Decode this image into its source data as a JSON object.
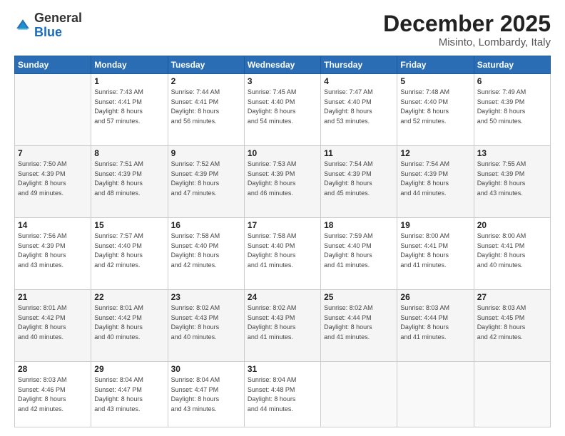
{
  "header": {
    "logo_general": "General",
    "logo_blue": "Blue",
    "month_title": "December 2025",
    "location": "Misinto, Lombardy, Italy"
  },
  "weekdays": [
    "Sunday",
    "Monday",
    "Tuesday",
    "Wednesday",
    "Thursday",
    "Friday",
    "Saturday"
  ],
  "weeks": [
    [
      {
        "day": "",
        "sunrise": "",
        "sunset": "",
        "daylight": ""
      },
      {
        "day": "1",
        "sunrise": "Sunrise: 7:43 AM",
        "sunset": "Sunset: 4:41 PM",
        "daylight": "Daylight: 8 hours and 57 minutes."
      },
      {
        "day": "2",
        "sunrise": "Sunrise: 7:44 AM",
        "sunset": "Sunset: 4:41 PM",
        "daylight": "Daylight: 8 hours and 56 minutes."
      },
      {
        "day": "3",
        "sunrise": "Sunrise: 7:45 AM",
        "sunset": "Sunset: 4:40 PM",
        "daylight": "Daylight: 8 hours and 54 minutes."
      },
      {
        "day": "4",
        "sunrise": "Sunrise: 7:47 AM",
        "sunset": "Sunset: 4:40 PM",
        "daylight": "Daylight: 8 hours and 53 minutes."
      },
      {
        "day": "5",
        "sunrise": "Sunrise: 7:48 AM",
        "sunset": "Sunset: 4:40 PM",
        "daylight": "Daylight: 8 hours and 52 minutes."
      },
      {
        "day": "6",
        "sunrise": "Sunrise: 7:49 AM",
        "sunset": "Sunset: 4:39 PM",
        "daylight": "Daylight: 8 hours and 50 minutes."
      }
    ],
    [
      {
        "day": "7",
        "sunrise": "Sunrise: 7:50 AM",
        "sunset": "Sunset: 4:39 PM",
        "daylight": "Daylight: 8 hours and 49 minutes."
      },
      {
        "day": "8",
        "sunrise": "Sunrise: 7:51 AM",
        "sunset": "Sunset: 4:39 PM",
        "daylight": "Daylight: 8 hours and 48 minutes."
      },
      {
        "day": "9",
        "sunrise": "Sunrise: 7:52 AM",
        "sunset": "Sunset: 4:39 PM",
        "daylight": "Daylight: 8 hours and 47 minutes."
      },
      {
        "day": "10",
        "sunrise": "Sunrise: 7:53 AM",
        "sunset": "Sunset: 4:39 PM",
        "daylight": "Daylight: 8 hours and 46 minutes."
      },
      {
        "day": "11",
        "sunrise": "Sunrise: 7:54 AM",
        "sunset": "Sunset: 4:39 PM",
        "daylight": "Daylight: 8 hours and 45 minutes."
      },
      {
        "day": "12",
        "sunrise": "Sunrise: 7:54 AM",
        "sunset": "Sunset: 4:39 PM",
        "daylight": "Daylight: 8 hours and 44 minutes."
      },
      {
        "day": "13",
        "sunrise": "Sunrise: 7:55 AM",
        "sunset": "Sunset: 4:39 PM",
        "daylight": "Daylight: 8 hours and 43 minutes."
      }
    ],
    [
      {
        "day": "14",
        "sunrise": "Sunrise: 7:56 AM",
        "sunset": "Sunset: 4:39 PM",
        "daylight": "Daylight: 8 hours and 43 minutes."
      },
      {
        "day": "15",
        "sunrise": "Sunrise: 7:57 AM",
        "sunset": "Sunset: 4:40 PM",
        "daylight": "Daylight: 8 hours and 42 minutes."
      },
      {
        "day": "16",
        "sunrise": "Sunrise: 7:58 AM",
        "sunset": "Sunset: 4:40 PM",
        "daylight": "Daylight: 8 hours and 42 minutes."
      },
      {
        "day": "17",
        "sunrise": "Sunrise: 7:58 AM",
        "sunset": "Sunset: 4:40 PM",
        "daylight": "Daylight: 8 hours and 41 minutes."
      },
      {
        "day": "18",
        "sunrise": "Sunrise: 7:59 AM",
        "sunset": "Sunset: 4:40 PM",
        "daylight": "Daylight: 8 hours and 41 minutes."
      },
      {
        "day": "19",
        "sunrise": "Sunrise: 8:00 AM",
        "sunset": "Sunset: 4:41 PM",
        "daylight": "Daylight: 8 hours and 41 minutes."
      },
      {
        "day": "20",
        "sunrise": "Sunrise: 8:00 AM",
        "sunset": "Sunset: 4:41 PM",
        "daylight": "Daylight: 8 hours and 40 minutes."
      }
    ],
    [
      {
        "day": "21",
        "sunrise": "Sunrise: 8:01 AM",
        "sunset": "Sunset: 4:42 PM",
        "daylight": "Daylight: 8 hours and 40 minutes."
      },
      {
        "day": "22",
        "sunrise": "Sunrise: 8:01 AM",
        "sunset": "Sunset: 4:42 PM",
        "daylight": "Daylight: 8 hours and 40 minutes."
      },
      {
        "day": "23",
        "sunrise": "Sunrise: 8:02 AM",
        "sunset": "Sunset: 4:43 PM",
        "daylight": "Daylight: 8 hours and 40 minutes."
      },
      {
        "day": "24",
        "sunrise": "Sunrise: 8:02 AM",
        "sunset": "Sunset: 4:43 PM",
        "daylight": "Daylight: 8 hours and 41 minutes."
      },
      {
        "day": "25",
        "sunrise": "Sunrise: 8:02 AM",
        "sunset": "Sunset: 4:44 PM",
        "daylight": "Daylight: 8 hours and 41 minutes."
      },
      {
        "day": "26",
        "sunrise": "Sunrise: 8:03 AM",
        "sunset": "Sunset: 4:44 PM",
        "daylight": "Daylight: 8 hours and 41 minutes."
      },
      {
        "day": "27",
        "sunrise": "Sunrise: 8:03 AM",
        "sunset": "Sunset: 4:45 PM",
        "daylight": "Daylight: 8 hours and 42 minutes."
      }
    ],
    [
      {
        "day": "28",
        "sunrise": "Sunrise: 8:03 AM",
        "sunset": "Sunset: 4:46 PM",
        "daylight": "Daylight: 8 hours and 42 minutes."
      },
      {
        "day": "29",
        "sunrise": "Sunrise: 8:04 AM",
        "sunset": "Sunset: 4:47 PM",
        "daylight": "Daylight: 8 hours and 43 minutes."
      },
      {
        "day": "30",
        "sunrise": "Sunrise: 8:04 AM",
        "sunset": "Sunset: 4:47 PM",
        "daylight": "Daylight: 8 hours and 43 minutes."
      },
      {
        "day": "31",
        "sunrise": "Sunrise: 8:04 AM",
        "sunset": "Sunset: 4:48 PM",
        "daylight": "Daylight: 8 hours and 44 minutes."
      },
      {
        "day": "",
        "sunrise": "",
        "sunset": "",
        "daylight": ""
      },
      {
        "day": "",
        "sunrise": "",
        "sunset": "",
        "daylight": ""
      },
      {
        "day": "",
        "sunrise": "",
        "sunset": "",
        "daylight": ""
      }
    ]
  ]
}
